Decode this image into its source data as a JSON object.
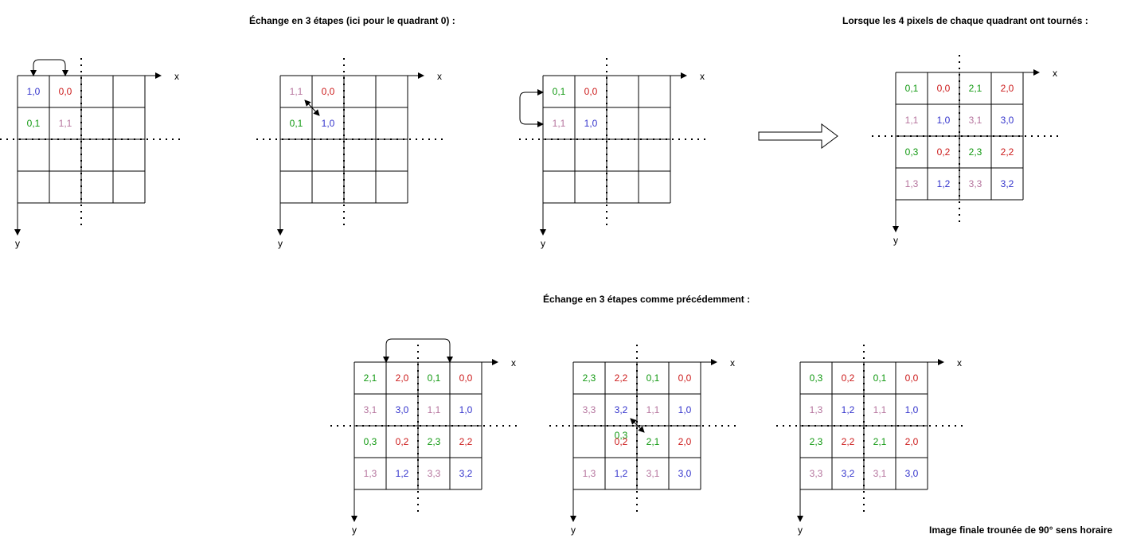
{
  "captions": {
    "top_title": "Échange en 3 étapes (ici pour le quadrant 0) :",
    "top_right_title": "Lorsque les 4 pixels de chaque quadrant ont tournés :",
    "bottom_title": "Échange en 3 étapes comme précédemment :",
    "final_note": "Image finale trounée de 90° sens horaire"
  },
  "axis_labels": {
    "x": "x",
    "y": "y"
  },
  "colors": {
    "blue": "#3333cc",
    "red": "#cc1a1a",
    "green": "#119911",
    "pink": "#b5739d",
    "grid": "#000000"
  },
  "grids": [
    {
      "name": "step1-swap",
      "cells": [
        [
          {
            "t": "1,0",
            "c": "blue"
          },
          {
            "t": "0,0",
            "c": "red"
          },
          {
            "t": "",
            "c": ""
          },
          {
            "t": "",
            "c": ""
          }
        ],
        [
          {
            "t": "0,1",
            "c": "green"
          },
          {
            "t": "1,1",
            "c": "pink"
          },
          {
            "t": "",
            "c": ""
          },
          {
            "t": "",
            "c": ""
          }
        ],
        [
          {
            "t": "",
            "c": ""
          },
          {
            "t": "",
            "c": ""
          },
          {
            "t": "",
            "c": ""
          },
          {
            "t": "",
            "c": ""
          }
        ],
        [
          {
            "t": "",
            "c": ""
          },
          {
            "t": "",
            "c": ""
          },
          {
            "t": "",
            "c": ""
          },
          {
            "t": "",
            "c": ""
          }
        ]
      ]
    },
    {
      "name": "step2-swap",
      "cells": [
        [
          {
            "t": "1,1",
            "c": "pink"
          },
          {
            "t": "0,0",
            "c": "red"
          },
          {
            "t": "",
            "c": ""
          },
          {
            "t": "",
            "c": ""
          }
        ],
        [
          {
            "t": "0,1",
            "c": "green"
          },
          {
            "t": "1,0",
            "c": "blue"
          },
          {
            "t": "",
            "c": ""
          },
          {
            "t": "",
            "c": ""
          }
        ],
        [
          {
            "t": "",
            "c": ""
          },
          {
            "t": "",
            "c": ""
          },
          {
            "t": "",
            "c": ""
          },
          {
            "t": "",
            "c": ""
          }
        ],
        [
          {
            "t": "",
            "c": ""
          },
          {
            "t": "",
            "c": ""
          },
          {
            "t": "",
            "c": ""
          },
          {
            "t": "",
            "c": ""
          }
        ]
      ]
    },
    {
      "name": "step3-swap",
      "cells": [
        [
          {
            "t": "0,1",
            "c": "green"
          },
          {
            "t": "0,0",
            "c": "red"
          },
          {
            "t": "",
            "c": ""
          },
          {
            "t": "",
            "c": ""
          }
        ],
        [
          {
            "t": "1,1",
            "c": "pink"
          },
          {
            "t": "1,0",
            "c": "blue"
          },
          {
            "t": "",
            "c": ""
          },
          {
            "t": "",
            "c": ""
          }
        ],
        [
          {
            "t": "",
            "c": ""
          },
          {
            "t": "",
            "c": ""
          },
          {
            "t": "",
            "c": ""
          },
          {
            "t": "",
            "c": ""
          }
        ],
        [
          {
            "t": "",
            "c": ""
          },
          {
            "t": "",
            "c": ""
          },
          {
            "t": "",
            "c": ""
          },
          {
            "t": "",
            "c": ""
          }
        ]
      ]
    },
    {
      "name": "all-quadrants-rotated",
      "cells": [
        [
          {
            "t": "0,1",
            "c": "green"
          },
          {
            "t": "0,0",
            "c": "red"
          },
          {
            "t": "2,1",
            "c": "green"
          },
          {
            "t": "2,0",
            "c": "red"
          }
        ],
        [
          {
            "t": "1,1",
            "c": "pink"
          },
          {
            "t": "1,0",
            "c": "blue"
          },
          {
            "t": "3,1",
            "c": "pink"
          },
          {
            "t": "3,0",
            "c": "blue"
          }
        ],
        [
          {
            "t": "0,3",
            "c": "green"
          },
          {
            "t": "0,2",
            "c": "red"
          },
          {
            "t": "2,3",
            "c": "green"
          },
          {
            "t": "2,2",
            "c": "red"
          }
        ],
        [
          {
            "t": "1,3",
            "c": "pink"
          },
          {
            "t": "1,2",
            "c": "blue"
          },
          {
            "t": "3,3",
            "c": "pink"
          },
          {
            "t": "3,2",
            "c": "blue"
          }
        ]
      ]
    },
    {
      "name": "quadrant-step1",
      "cells": [
        [
          {
            "t": "2,1",
            "c": "green"
          },
          {
            "t": "2,0",
            "c": "red"
          },
          {
            "t": "0,1",
            "c": "green"
          },
          {
            "t": "0,0",
            "c": "red"
          }
        ],
        [
          {
            "t": "3,1",
            "c": "pink"
          },
          {
            "t": "3,0",
            "c": "blue"
          },
          {
            "t": "1,1",
            "c": "pink"
          },
          {
            "t": "1,0",
            "c": "blue"
          }
        ],
        [
          {
            "t": "0,3",
            "c": "green"
          },
          {
            "t": "0,2",
            "c": "red"
          },
          {
            "t": "2,3",
            "c": "green"
          },
          {
            "t": "2,2",
            "c": "red"
          }
        ],
        [
          {
            "t": "1,3",
            "c": "pink"
          },
          {
            "t": "1,2",
            "c": "blue"
          },
          {
            "t": "3,3",
            "c": "pink"
          },
          {
            "t": "3,2",
            "c": "blue"
          }
        ]
      ]
    },
    {
      "name": "quadrant-step2",
      "cells": [
        [
          {
            "t": "2,3",
            "c": "green"
          },
          {
            "t": "2,2",
            "c": "red"
          },
          {
            "t": "0,1",
            "c": "green"
          },
          {
            "t": "0,0",
            "c": "red"
          }
        ],
        [
          {
            "t": "3,3",
            "c": "pink"
          },
          {
            "t": "3,2",
            "c": "blue"
          },
          {
            "t": "1,1",
            "c": "pink"
          },
          {
            "t": "1,0",
            "c": "blue"
          }
        ],
        [
          {
            "t": "0,3",
            "c": "green"
          },
          {
            "t": "0,2",
            "c": "red"
          },
          {
            "t": "2,1",
            "c": "green"
          },
          {
            "t": "2,0",
            "c": "red"
          }
        ],
        [
          {
            "t": "1,3",
            "c": "pink"
          },
          {
            "t": "1,2",
            "c": "blue"
          },
          {
            "t": "3,1",
            "c": "pink"
          },
          {
            "t": "3,0",
            "c": "blue"
          }
        ]
      ]
    },
    {
      "name": "final-image",
      "cells": [
        [
          {
            "t": "0,3",
            "c": "green"
          },
          {
            "t": "0,2",
            "c": "red"
          },
          {
            "t": "0,1",
            "c": "green"
          },
          {
            "t": "0,0",
            "c": "red"
          }
        ],
        [
          {
            "t": "1,3",
            "c": "pink"
          },
          {
            "t": "1,2",
            "c": "blue"
          },
          {
            "t": "1,1",
            "c": "pink"
          },
          {
            "t": "1,0",
            "c": "blue"
          }
        ],
        [
          {
            "t": "2,3",
            "c": "green"
          },
          {
            "t": "2,2",
            "c": "red"
          },
          {
            "t": "2,1",
            "c": "green"
          },
          {
            "t": "2,0",
            "c": "red"
          }
        ],
        [
          {
            "t": "3,3",
            "c": "pink"
          },
          {
            "t": "3,2",
            "c": "blue"
          },
          {
            "t": "3,1",
            "c": "pink"
          },
          {
            "t": "3,0",
            "c": "blue"
          }
        ]
      ]
    }
  ]
}
